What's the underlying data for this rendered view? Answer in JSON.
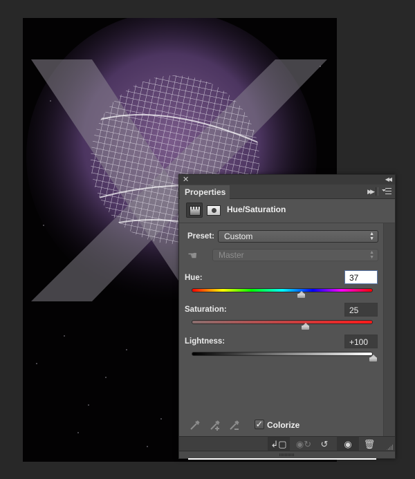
{
  "panel": {
    "tab_label": "Properties",
    "adjustment_title": "Hue/Saturation",
    "icons": {
      "close": "close-icon",
      "collapse": "collapse-double-arrow-icon",
      "expand": "expand-double-arrow-icon",
      "menu": "panel-menu-icon",
      "adjustment": "hue-saturation-adjustment-icon",
      "mask": "layer-mask-icon",
      "targeted_adjustment": "hand-targeted-adjustment-icon"
    },
    "glyphs": {
      "close": "✕",
      "collapse": "◀◀",
      "expand": "▶▶",
      "hand": "☚",
      "check": "✓",
      "select_arrows": "▲▼"
    }
  },
  "preset": {
    "label": "Preset:",
    "value": "Custom"
  },
  "channel": {
    "value": "Master"
  },
  "hue": {
    "label": "Hue:",
    "value": "37",
    "min": -180,
    "max": 180,
    "numeric": 37
  },
  "saturation": {
    "label": "Saturation:",
    "value": "25",
    "min": -100,
    "max": 100,
    "numeric": 25
  },
  "lightness": {
    "label": "Lightness:",
    "value": "+100",
    "min": -100,
    "max": 100,
    "numeric": 100
  },
  "colorize": {
    "label": "Colorize",
    "checked": true
  },
  "eyedroppers": [
    "eyedropper-icon",
    "eyedropper-add-icon",
    "eyedropper-subtract-icon"
  ],
  "footer_buttons": [
    {
      "name": "clip-to-layer-button",
      "glyph": "↲▢"
    },
    {
      "name": "view-previous-state-button",
      "glyph": "👁↻"
    },
    {
      "name": "reset-button",
      "glyph": "↺"
    },
    {
      "name": "toggle-visibility-button",
      "glyph": "👁"
    },
    {
      "name": "delete-button",
      "glyph": "🗑"
    }
  ]
}
